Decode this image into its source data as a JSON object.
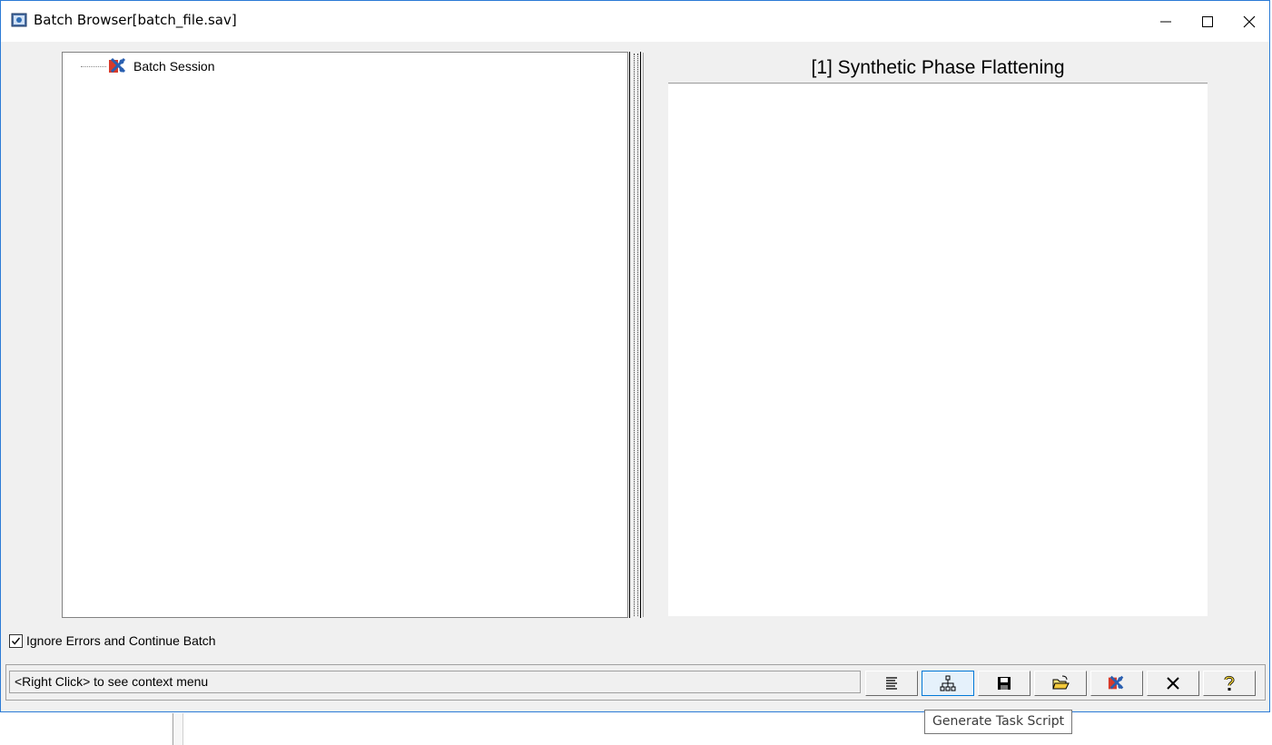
{
  "window": {
    "title": "Batch Browser[batch_file.sav]",
    "icon": "batch-browser-app-icon",
    "controls": [
      "minimize-icon",
      "maximize-icon",
      "close-icon"
    ]
  },
  "tree": {
    "items": [
      {
        "label": "Batch Session",
        "icon": "batch-session-icon"
      }
    ]
  },
  "detail": {
    "header": "[1] Synthetic Phase Flattening"
  },
  "options": {
    "ignore_errors_label": "Ignore Errors and Continue Batch",
    "ignore_errors_checked": true
  },
  "statusbar": {
    "hint": "<Right Click> to see context menu",
    "buttons": [
      {
        "icon": "list-icon",
        "active": false
      },
      {
        "icon": "hierarchy-icon",
        "active": true
      },
      {
        "icon": "save-icon",
        "active": false
      },
      {
        "icon": "open-folder-icon",
        "active": false
      },
      {
        "icon": "batch-session-icon",
        "active": false
      },
      {
        "icon": "close-icon",
        "active": false
      },
      {
        "icon": "help-icon",
        "active": false
      }
    ]
  },
  "tooltip": {
    "text": "Generate Task Script"
  },
  "colors": {
    "window_border": "#2b7bd6",
    "active_button_bg": "#e5f1fb",
    "active_button_border": "#0078d7"
  }
}
